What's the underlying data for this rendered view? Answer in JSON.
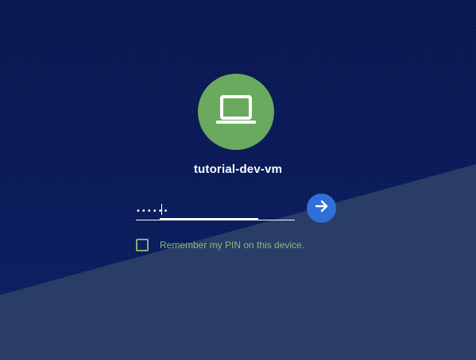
{
  "host": {
    "name": "tutorial-dev-vm",
    "avatar_icon": "laptop-icon",
    "avatar_color": "#6aaa5e"
  },
  "pin": {
    "value": "••••••",
    "submit_icon": "arrow-right-icon",
    "submit_color": "#2e6fd8"
  },
  "remember": {
    "label": "Remember my PIN on this device.",
    "checked": false,
    "color": "#7fbf7b"
  },
  "theme": {
    "background": "#0b1a5c",
    "lower_background": "#2a3d66"
  }
}
